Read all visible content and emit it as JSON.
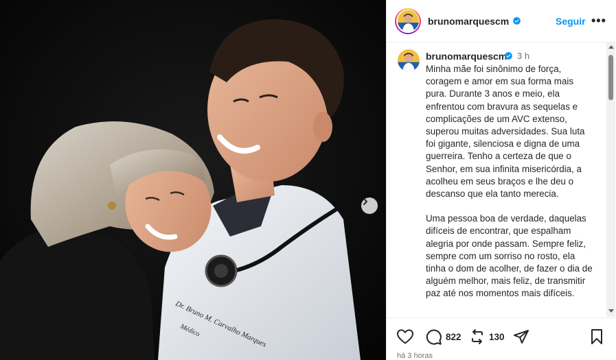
{
  "post": {
    "username": "brunomarquescm",
    "follow_label": "Seguir",
    "more_label": "•••",
    "caption": {
      "username": "brunomarquescm",
      "time": "3 h",
      "paragraphs": [
        "Minha mãe foi sinônimo de força, coragem e amor em sua forma mais pura. Durante 3 anos e meio, ela enfrentou com bravura as sequelas e complicações de um AVC extenso, superou muitas adversidades. Sua luta foi gigante, silenciosa e digna de uma guerreira. Tenho a certeza de que o Senhor, em sua infinita misericórdia, a acolheu em seus braços e lhe deu o descanso que ela tanto merecia.",
        "Uma pessoa boa de verdade, daquelas difíceis de encontrar, que espalham alegria por onde passam. Sempre feliz, sempre com um sorriso no rosto, ela tinha o dom de acolher, de fazer o dia de alguém melhor, mais feliz, de transmitir paz até nos momentos mais difíceis."
      ]
    },
    "actions": {
      "comment_count": "822",
      "repost_count": "130"
    },
    "footer_time": "há 3 horas",
    "photo": {
      "coat_text": "Dr. Bruno M. Carvalho Marques",
      "coat_subtext": "Médico"
    }
  },
  "icons": {
    "like": "heart-icon",
    "comment": "comment-icon",
    "repost": "repost-icon",
    "share": "send-icon",
    "save": "bookmark-icon",
    "next": "chevron-right-icon",
    "verified": "verified-badge-icon"
  },
  "colors": {
    "accent": "#0095f6",
    "verified": "#0095f6",
    "muted": "#737373",
    "text": "#262626"
  }
}
